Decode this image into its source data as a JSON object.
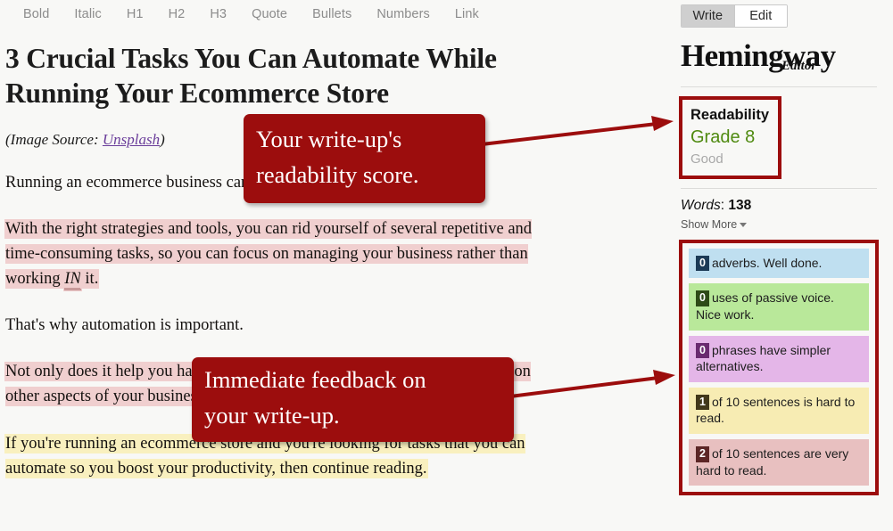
{
  "toolbar": {
    "buttons": [
      {
        "label": "Bold",
        "name": "bold"
      },
      {
        "label": "Italic",
        "name": "italic"
      },
      {
        "label": "H1",
        "name": "h1"
      },
      {
        "label": "H2",
        "name": "h2"
      },
      {
        "label": "H3",
        "name": "h3"
      },
      {
        "label": "Quote",
        "name": "quote"
      },
      {
        "label": "Bullets",
        "name": "bullets"
      },
      {
        "label": "Numbers",
        "name": "numbers"
      },
      {
        "label": "Link",
        "name": "link"
      }
    ]
  },
  "document": {
    "title": "3 Crucial Tasks You Can Automate While Running Your Ecommerce Store",
    "image_source_prefix": "(Image Source: ",
    "image_source_link": "Unsplash",
    "image_source_suffix": ")",
    "paragraphs": [
      {
        "id": "p1",
        "highlight": "none",
        "text": "Running an ecommerce business can be a back-breaking experience."
      },
      {
        "id": "p2",
        "highlight": "red",
        "text_before": "With the right strategies and tools, you can rid yourself of several repetitive and time-consuming tasks, so you can focus on managing your business rather than working ",
        "adverb": "IN",
        "text_after": " it."
      },
      {
        "id": "p3",
        "highlight": "none",
        "text": "That's why automation is important."
      },
      {
        "id": "p4",
        "highlight": "red",
        "text": "Not only does it help you handle your tasks with ease, allowing you to focus on other aspects of your business."
      },
      {
        "id": "p5",
        "highlight": "yellow",
        "text_before": "If you're running an ecommerce store and you're looking for tasks that you can automate so you boost your produ",
        "text_after": "ctivity, then continue reading."
      }
    ]
  },
  "annotations": [
    {
      "name": "readability-callout",
      "line1": "Your write-up's",
      "line2": "readability score."
    },
    {
      "name": "feedback-callout",
      "line1": "Immediate feedback on",
      "line2": "your write-up."
    }
  ],
  "sidebar": {
    "tabs": [
      {
        "label": "Write",
        "active": true
      },
      {
        "label": "Edit",
        "active": false
      }
    ],
    "brand": {
      "main": "Hemingway",
      "sub": "Editor"
    },
    "readability": {
      "label": "Readability",
      "grade": "Grade 8",
      "verdict": "Good",
      "grade_color": "#4f8a10",
      "verdict_color": "#a8a8a8",
      "highlight_border": "#9c0d0d"
    },
    "words": {
      "label": "Words",
      "separator": ": ",
      "count": "138"
    },
    "show_more": "Show More",
    "stats": [
      {
        "name": "adverbs",
        "count": "0",
        "text": "adverbs. Well done.",
        "bg": "#bfdff0",
        "badge_bg": "#1c3a56"
      },
      {
        "name": "passive-voice",
        "count": "0",
        "text": "uses of passive voice. Nice work.",
        "bg": "#b9e89a",
        "badge_bg": "#2e4a17"
      },
      {
        "name": "simpler-alternatives",
        "count": "0",
        "text": "phrases have simpler alternatives.",
        "bg": "#e4b6e8",
        "badge_bg": "#6a2b70"
      },
      {
        "name": "hard-sentences",
        "count": "1",
        "text": "of 10 sentences is hard to read.",
        "bg": "#f7ecb3",
        "badge_bg": "#42381a"
      },
      {
        "name": "very-hard-sentences",
        "count": "2",
        "text": "of 10 sentences are very hard to read.",
        "bg": "#e8c0c0",
        "badge_bg": "#5c2626"
      }
    ]
  },
  "colors": {
    "accent_red": "#9c0d0d",
    "highlight_red": "#f0cfcf",
    "highlight_yellow": "#f9f0bf",
    "page_bg": "#f8f8f6"
  }
}
